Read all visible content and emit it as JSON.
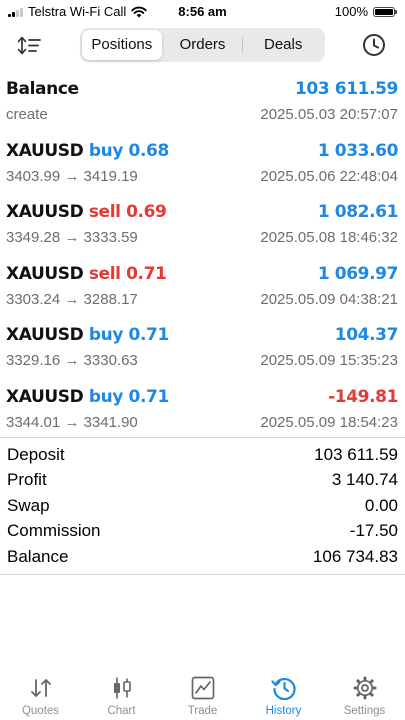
{
  "status_bar": {
    "carrier": "Telstra Wi-Fi Call",
    "time": "8:56 am",
    "battery": "100%"
  },
  "toolbar": {
    "segments": [
      "Positions",
      "Orders",
      "Deals"
    ],
    "active_segment": "Positions"
  },
  "deals": [
    {
      "symbol": "Balance",
      "side": "",
      "side_class": "",
      "volume": "",
      "amount": "103 611.59",
      "amount_class": "pos",
      "detail": "create",
      "time": "2025.05.03 20:57:07"
    },
    {
      "symbol": "XAUUSD",
      "side": "buy",
      "side_class": "buy",
      "volume": "0.68",
      "amount": "1 033.60",
      "amount_class": "pos",
      "detail": "3403.99 → 3419.19",
      "time": "2025.05.06 22:48:04"
    },
    {
      "symbol": "XAUUSD",
      "side": "sell",
      "side_class": "sell",
      "volume": "0.69",
      "amount": "1 082.61",
      "amount_class": "pos",
      "detail": "3349.28 → 3333.59",
      "time": "2025.05.08 18:46:32"
    },
    {
      "symbol": "XAUUSD",
      "side": "sell",
      "side_class": "sell",
      "volume": "0.71",
      "amount": "1 069.97",
      "amount_class": "pos",
      "detail": "3303.24 → 3288.17",
      "time": "2025.05.09 04:38:21"
    },
    {
      "symbol": "XAUUSD",
      "side": "buy",
      "side_class": "buy",
      "volume": "0.71",
      "amount": "104.37",
      "amount_class": "pos",
      "detail": "3329.16 → 3330.63",
      "time": "2025.05.09 15:35:23"
    },
    {
      "symbol": "XAUUSD",
      "side": "buy",
      "side_class": "buy",
      "volume": "0.71",
      "amount": "-149.81",
      "amount_class": "neg",
      "detail": "3344.01 → 3341.90",
      "time": "2025.05.09 18:54:23"
    }
  ],
  "summary": [
    {
      "label": "Deposit",
      "value": "103 611.59"
    },
    {
      "label": "Profit",
      "value": "3 140.74"
    },
    {
      "label": "Swap",
      "value": "0.00"
    },
    {
      "label": "Commission",
      "value": "-17.50"
    },
    {
      "label": "Balance",
      "value": "106 734.83"
    }
  ],
  "tabbar": [
    {
      "label": "Quotes",
      "icon": "quotes-icon",
      "active": false
    },
    {
      "label": "Chart",
      "icon": "chart-icon",
      "active": false
    },
    {
      "label": "Trade",
      "icon": "trade-icon",
      "active": false
    },
    {
      "label": "History",
      "icon": "history-icon",
      "active": true
    },
    {
      "label": "Settings",
      "icon": "settings-icon",
      "active": false
    }
  ],
  "colors": {
    "accent": "#1e88e5",
    "negative": "#e53935",
    "muted": "#6d6d6d"
  }
}
